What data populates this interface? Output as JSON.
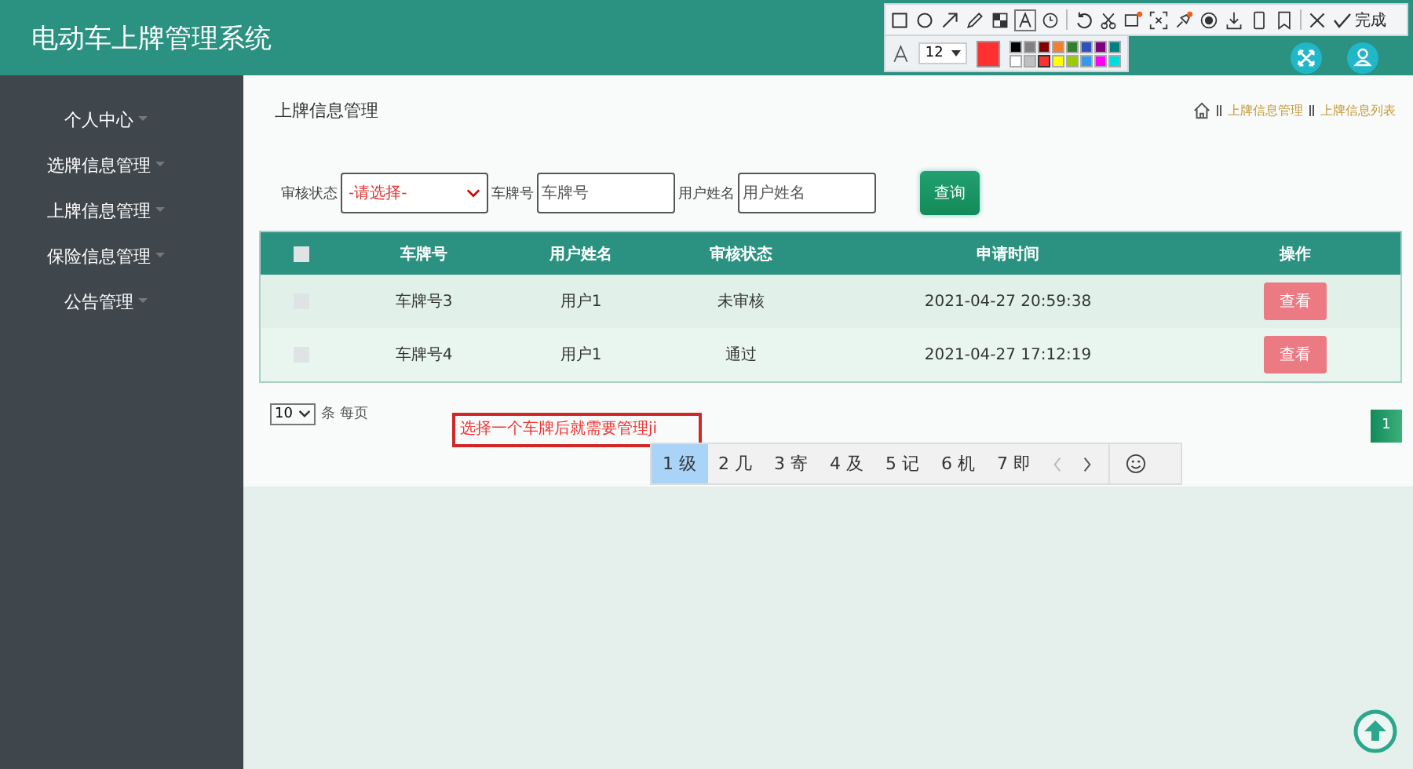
{
  "header": {
    "title": "电动车上牌管理系统"
  },
  "sidebar": {
    "items": [
      {
        "label": "个人中心"
      },
      {
        "label": "选牌信息管理"
      },
      {
        "label": "上牌信息管理"
      },
      {
        "label": "保险信息管理"
      },
      {
        "label": "公告管理"
      }
    ]
  },
  "page": {
    "title": "上牌信息管理",
    "breadcrumb": [
      "上牌信息管理",
      "上牌信息列表"
    ]
  },
  "filters": [
    {
      "kind": "select",
      "label": "审核状态",
      "value": "-请选择-"
    },
    {
      "kind": "input",
      "label": "车牌号",
      "placeholder": "车牌号"
    },
    {
      "kind": "input",
      "label": "用户姓名",
      "placeholder": "用户姓名"
    }
  ],
  "search_button": "查询",
  "table": {
    "all_checked": false,
    "columns": [
      "车牌号",
      "用户姓名",
      "审核状态",
      "申请时间",
      "操作"
    ],
    "rows": [
      {
        "checked": false,
        "cells": [
          "车牌号3",
          "用户1",
          "未审核",
          "2021-04-27 20:59:38"
        ],
        "action": "查看"
      },
      {
        "checked": false,
        "cells": [
          "车牌号4",
          "用户1",
          "通过",
          "2021-04-27 17:12:19"
        ],
        "action": "查看"
      }
    ]
  },
  "pagination": {
    "page_size": "10",
    "page_size_label": "条 每页",
    "pages": [
      {
        "label": "1",
        "selected": true
      }
    ]
  },
  "annotation": {
    "text": "选择一个车牌后就需要管理ji"
  },
  "ime": {
    "candidates": [
      {
        "label": "1 级",
        "selected": true
      },
      {
        "label": "2 几",
        "selected": false
      },
      {
        "label": "3 寄",
        "selected": false
      },
      {
        "label": "4 及",
        "selected": false
      },
      {
        "label": "5 记",
        "selected": false
      },
      {
        "label": "6 机",
        "selected": false
      },
      {
        "label": "7 即",
        "selected": false
      }
    ]
  },
  "capture_toolbar": {
    "done": "完成",
    "font_size": "12",
    "palette": [
      {
        "color": "#000000",
        "selected": false
      },
      {
        "color": "#808080",
        "selected": false
      },
      {
        "color": "#800000",
        "selected": false
      },
      {
        "color": "#f08030",
        "selected": false
      },
      {
        "color": "#308030",
        "selected": false
      },
      {
        "color": "#3050c0",
        "selected": false
      },
      {
        "color": "#800080",
        "selected": false
      },
      {
        "color": "#008080",
        "selected": false
      },
      {
        "color": "#ffffff",
        "selected": false
      },
      {
        "color": "#c0c0c0",
        "selected": false
      },
      {
        "color": "#ff3030",
        "selected": true
      },
      {
        "color": "#ffff00",
        "selected": false
      },
      {
        "color": "#99cc00",
        "selected": false
      },
      {
        "color": "#3399ee",
        "selected": false
      },
      {
        "color": "#ff00ff",
        "selected": false
      },
      {
        "color": "#00dddd",
        "selected": false
      }
    ]
  }
}
